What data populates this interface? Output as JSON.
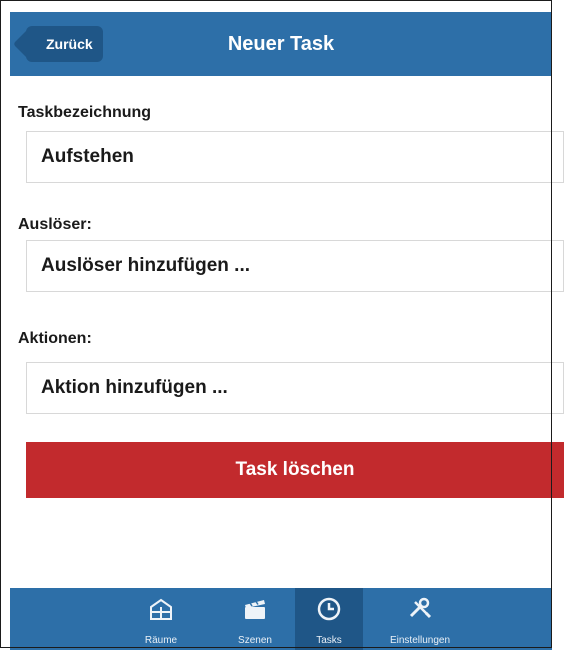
{
  "header": {
    "back_label": "Zurück",
    "title": "Neuer Task"
  },
  "form": {
    "name_label": "Taskbezeichnung",
    "name_value": "Aufstehen",
    "triggers_label": "Auslöser:",
    "triggers_placeholder": "Auslöser hinzufügen ...",
    "actions_label": "Aktionen:",
    "actions_placeholder": "Aktion hinzufügen ..."
  },
  "delete_button": "Task löschen",
  "tabs": [
    {
      "label": "Räume",
      "icon": "rooms-icon",
      "active": false
    },
    {
      "label": "Szenen",
      "icon": "scenes-icon",
      "active": false
    },
    {
      "label": "Tasks",
      "icon": "clock-icon",
      "active": true
    },
    {
      "label": "Einstellungen",
      "icon": "settings-icon",
      "active": false
    }
  ],
  "colors": {
    "header_blue": "#2d6fa8",
    "active_blue": "#1f5687",
    "delete_red": "#c22a2d"
  }
}
